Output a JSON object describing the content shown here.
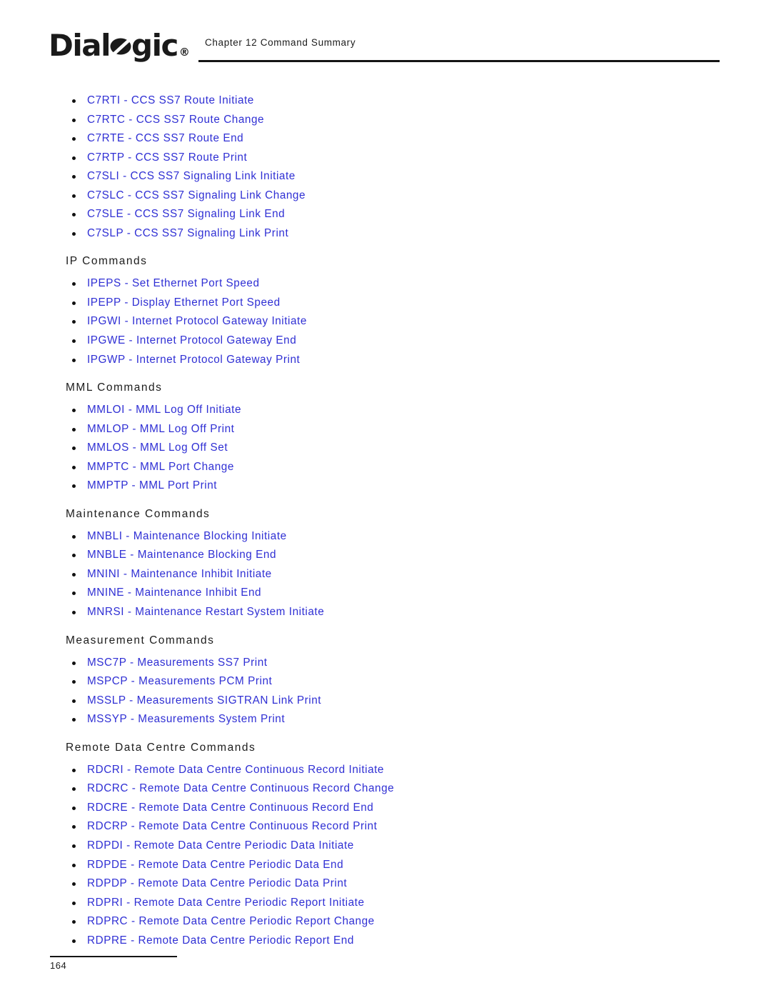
{
  "header": {
    "logo": {
      "text_before": "Dial",
      "o_glyph": "slashed-oval-o",
      "text_after": "gic",
      "registered_mark": "®",
      "full_name": "Dialogic"
    },
    "chapter_label": "Chapter 12 Command Summary"
  },
  "sections": [
    {
      "heading": null,
      "items": [
        {
          "code": "C7RTI",
          "description": "CCS SS7 Route Initiate",
          "label": "C7RTI - CCS SS7 Route Initiate"
        },
        {
          "code": "C7RTC",
          "description": "CCS SS7 Route Change",
          "label": "C7RTC - CCS SS7 Route Change"
        },
        {
          "code": "C7RTE",
          "description": "CCS SS7 Route End",
          "label": "C7RTE - CCS SS7 Route End"
        },
        {
          "code": "C7RTP",
          "description": "CCS SS7 Route Print",
          "label": "C7RTP - CCS SS7 Route Print"
        },
        {
          "code": "C7SLI",
          "description": "CCS SS7 Signaling Link Initiate",
          "label": "C7SLI - CCS SS7 Signaling Link Initiate"
        },
        {
          "code": "C7SLC",
          "description": "CCS SS7 Signaling Link Change",
          "label": "C7SLC - CCS SS7 Signaling Link Change"
        },
        {
          "code": "C7SLE",
          "description": "CCS SS7 Signaling Link End",
          "label": "C7SLE - CCS SS7 Signaling Link End"
        },
        {
          "code": "C7SLP",
          "description": "CCS SS7 Signaling Link Print",
          "label": "C7SLP - CCS SS7 Signaling Link Print"
        }
      ]
    },
    {
      "heading": "IP Commands",
      "items": [
        {
          "code": "IPEPS",
          "description": "Set Ethernet Port Speed",
          "label": "IPEPS - Set Ethernet Port Speed"
        },
        {
          "code": "IPEPP",
          "description": "Display Ethernet Port Speed",
          "label": "IPEPP - Display Ethernet Port Speed"
        },
        {
          "code": "IPGWI",
          "description": "Internet Protocol Gateway Initiate",
          "label": "IPGWI - Internet Protocol Gateway Initiate"
        },
        {
          "code": "IPGWE",
          "description": "Internet Protocol Gateway End",
          "label": "IPGWE - Internet Protocol Gateway End"
        },
        {
          "code": "IPGWP",
          "description": "Internet Protocol Gateway Print",
          "label": "IPGWP - Internet Protocol Gateway Print"
        }
      ]
    },
    {
      "heading": "MML Commands",
      "items": [
        {
          "code": "MMLOI",
          "description": "MML Log Off Initiate",
          "label": "MMLOI - MML Log Off Initiate"
        },
        {
          "code": "MMLOP",
          "description": "MML Log Off Print",
          "label": "MMLOP - MML Log Off Print"
        },
        {
          "code": "MMLOS",
          "description": "MML Log Off Set",
          "label": "MMLOS - MML Log Off Set"
        },
        {
          "code": "MMPTC",
          "description": "MML Port Change",
          "label": "MMPTC - MML Port Change"
        },
        {
          "code": "MMPTP",
          "description": "MML Port Print",
          "label": "MMPTP - MML Port Print"
        }
      ]
    },
    {
      "heading": "Maintenance Commands",
      "items": [
        {
          "code": "MNBLI",
          "description": "Maintenance Blocking Initiate",
          "label": "MNBLI - Maintenance Blocking Initiate"
        },
        {
          "code": "MNBLE",
          "description": "Maintenance Blocking End",
          "label": "MNBLE - Maintenance Blocking End"
        },
        {
          "code": "MNINI",
          "description": "Maintenance Inhibit Initiate",
          "label": "MNINI - Maintenance Inhibit Initiate"
        },
        {
          "code": "MNINE",
          "description": "Maintenance Inhibit End",
          "label": "MNINE - Maintenance Inhibit End"
        },
        {
          "code": "MNRSI",
          "description": "Maintenance Restart System Initiate",
          "label": "MNRSI - Maintenance Restart System Initiate"
        }
      ]
    },
    {
      "heading": "Measurement Commands",
      "items": [
        {
          "code": "MSC7P",
          "description": "Measurements SS7 Print",
          "label": "MSC7P - Measurements SS7 Print"
        },
        {
          "code": "MSPCP",
          "description": "Measurements PCM Print",
          "label": "MSPCP - Measurements PCM Print"
        },
        {
          "code": "MSSLP",
          "description": "Measurements SIGTRAN Link Print",
          "label": "MSSLP - Measurements SIGTRAN Link Print"
        },
        {
          "code": "MSSYP",
          "description": "Measurements System Print",
          "label": "MSSYP - Measurements System Print"
        }
      ]
    },
    {
      "heading": "Remote Data Centre Commands",
      "items": [
        {
          "code": "RDCRI",
          "description": "Remote Data Centre Continuous Record Initiate",
          "label": "RDCRI - Remote Data Centre Continuous Record Initiate"
        },
        {
          "code": "RDCRC",
          "description": "Remote Data Centre Continuous Record Change",
          "label": "RDCRC - Remote Data Centre Continuous Record Change"
        },
        {
          "code": "RDCRE",
          "description": "Remote Data Centre Continuous Record End",
          "label": "RDCRE - Remote Data Centre Continuous Record End"
        },
        {
          "code": "RDCRP",
          "description": "Remote Data Centre Continuous Record Print",
          "label": "RDCRP - Remote Data Centre Continuous Record Print"
        },
        {
          "code": "RDPDI",
          "description": "Remote Data Centre Periodic Data Initiate",
          "label": "RDPDI - Remote Data Centre Periodic Data Initiate"
        },
        {
          "code": "RDPDE",
          "description": "Remote Data Centre Periodic Data End",
          "label": "RDPDE - Remote Data Centre Periodic Data End"
        },
        {
          "code": "RDPDP",
          "description": "Remote Data Centre Periodic Data Print",
          "label": "RDPDP - Remote Data Centre Periodic Data Print"
        },
        {
          "code": "RDPRI",
          "description": "Remote Data Centre Periodic Report Initiate",
          "label": "RDPRI - Remote Data Centre Periodic Report Initiate"
        },
        {
          "code": "RDPRC",
          "description": "Remote Data Centre Periodic Report Change",
          "label": "RDPRC - Remote Data Centre Periodic Report Change"
        },
        {
          "code": "RDPRE",
          "description": "Remote Data Centre Periodic Report End",
          "label": "RDPRE - Remote Data Centre Periodic Report End"
        }
      ]
    }
  ],
  "footer": {
    "page_number": "164"
  },
  "colors": {
    "link_blue": "#2f2fd4",
    "text_black": "#1c1c1c",
    "rule_black": "#141414",
    "page_background": "#ffffff"
  }
}
